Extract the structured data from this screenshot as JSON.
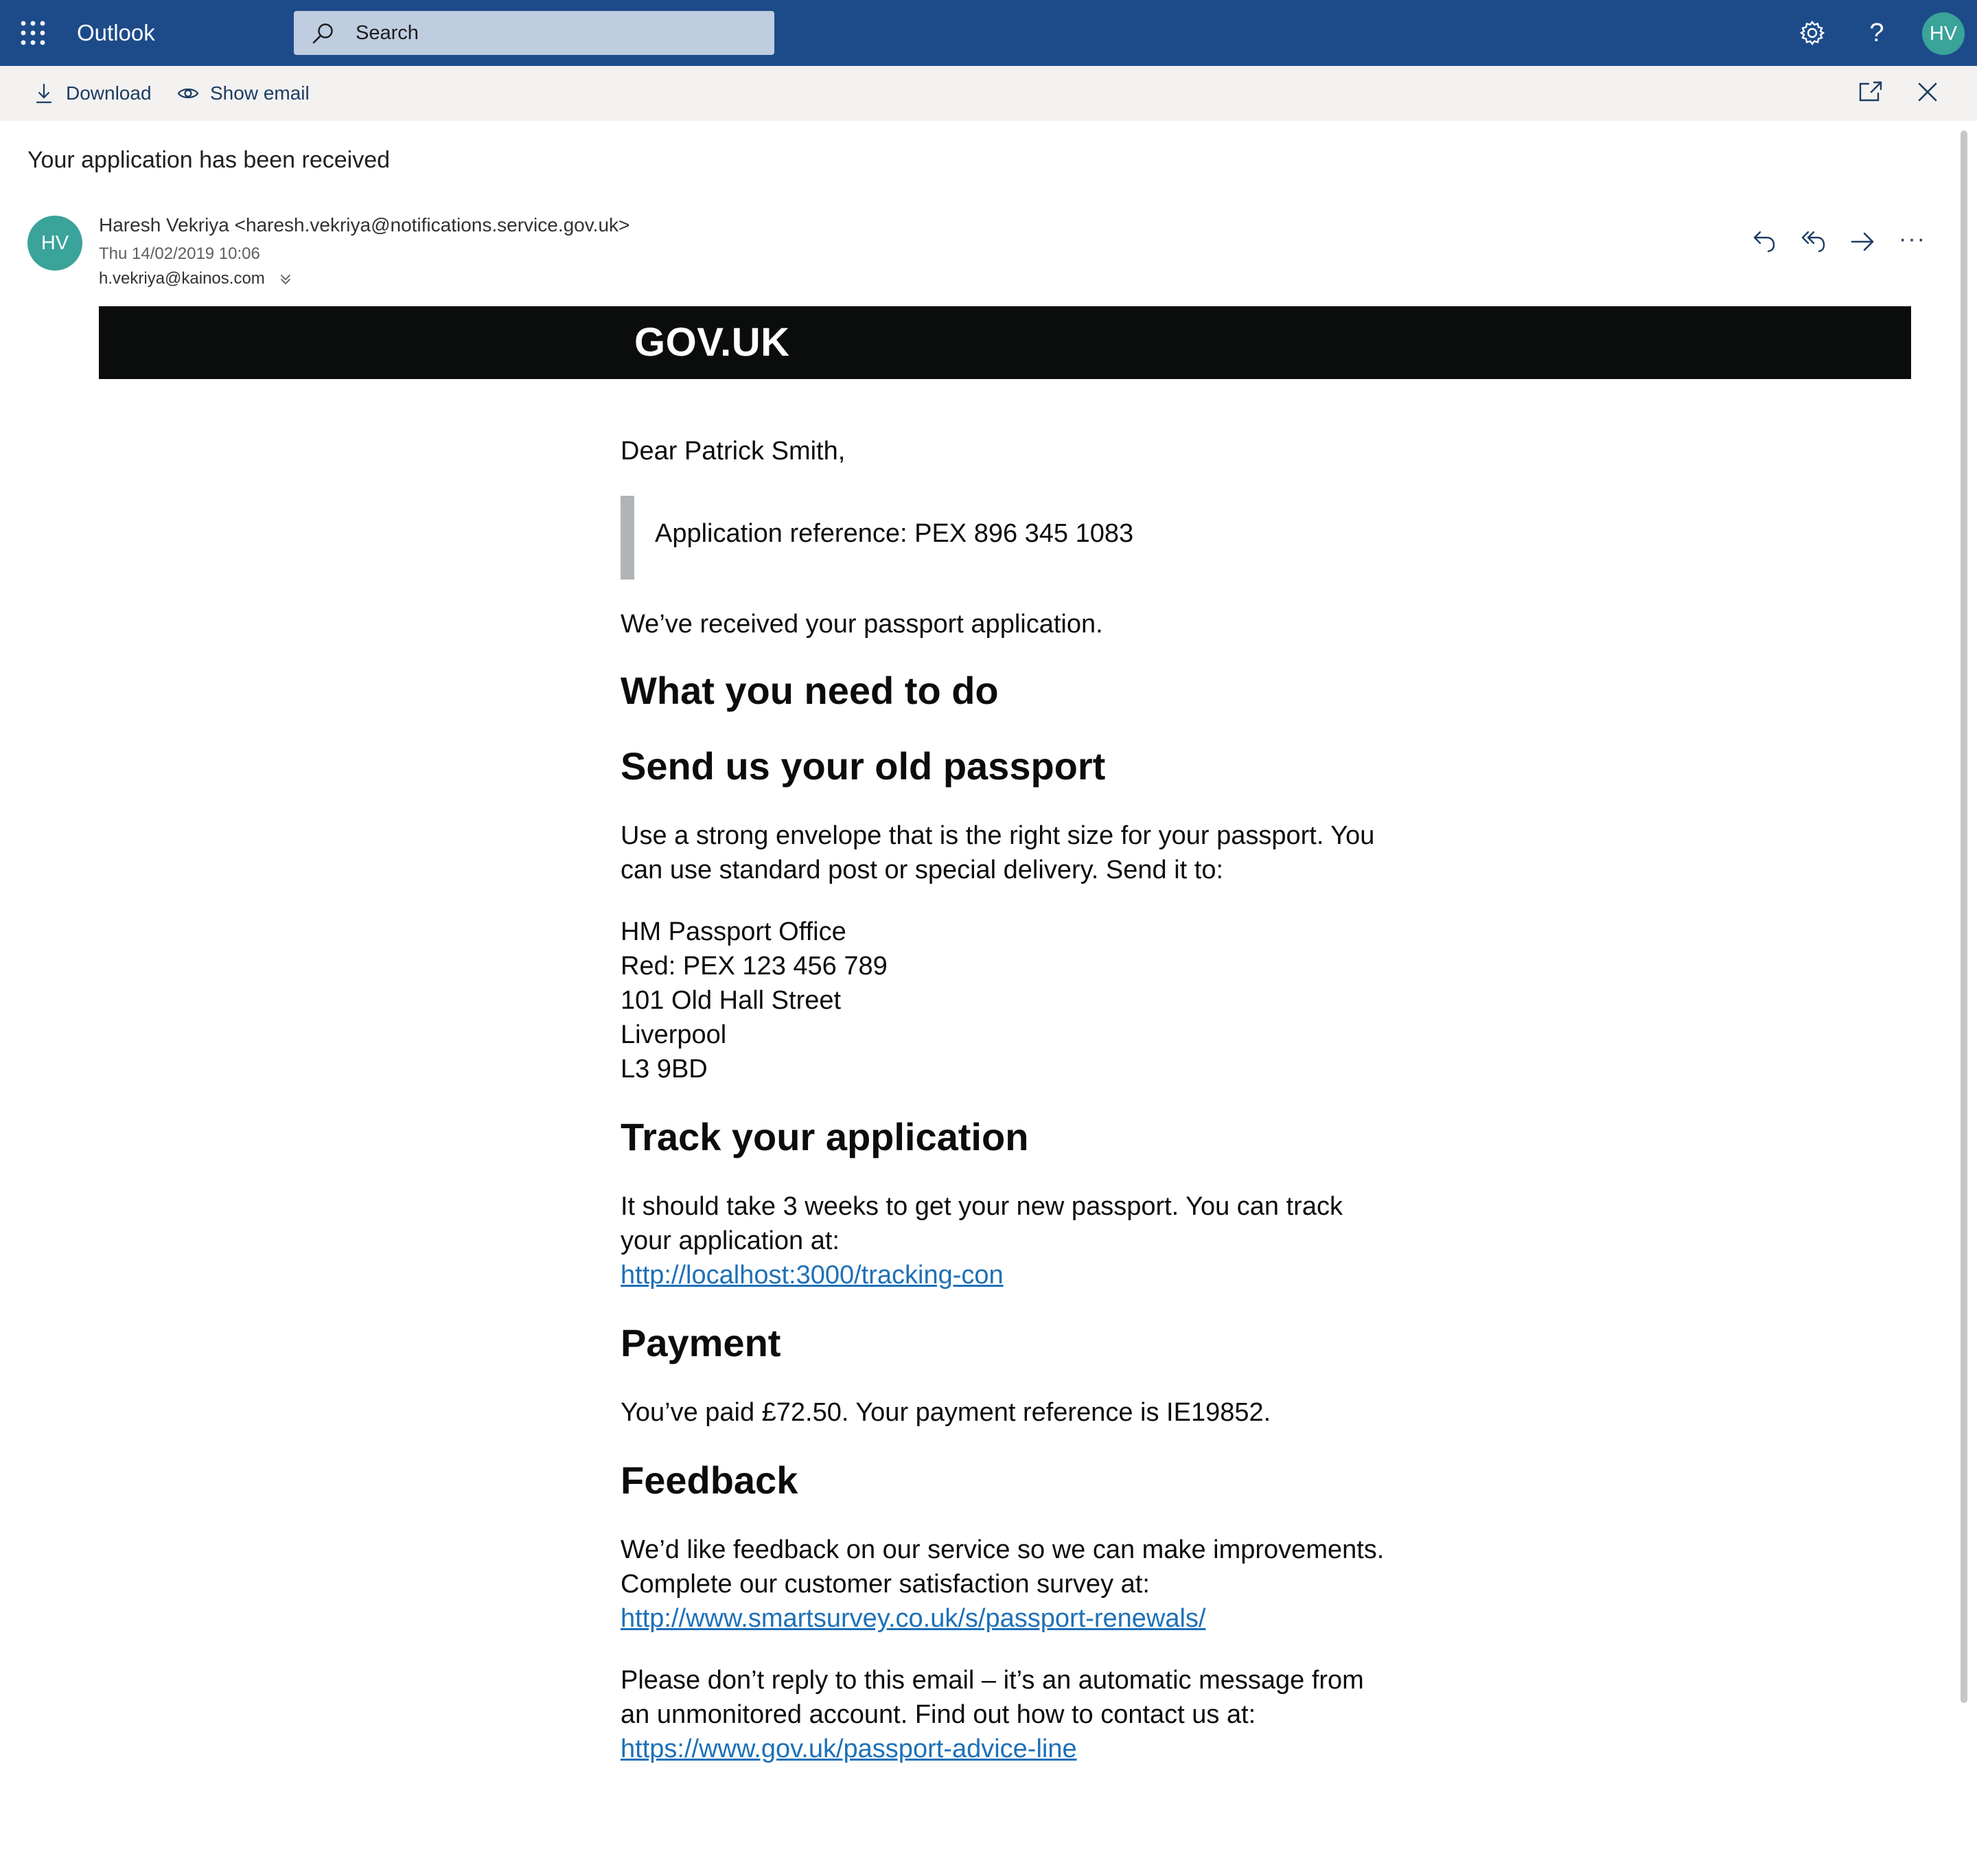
{
  "suite": {
    "app_name": "Outlook",
    "search_placeholder": "Search",
    "help_glyph": "?",
    "user_initials": "HV",
    "bar_color": "#1d4b8a",
    "icons": [
      "app-launcher-icon",
      "search-icon",
      "settings-gear-icon",
      "help-icon"
    ]
  },
  "commands": {
    "download_label": "Download",
    "show_email_label": "Show email",
    "icons": [
      "download-icon",
      "eye-icon",
      "open-in-new-window-icon",
      "close-icon"
    ]
  },
  "message": {
    "subject": "Your application has been received",
    "sender_initials": "HV",
    "sender": "Haresh Vekriya <haresh.vekriya@notifications.service.gov.uk>",
    "date": "Thu 14/02/2019 10:06",
    "to": "h.vekriya@kainos.com",
    "more_glyph": "···",
    "avatar_color": "#3aa39a"
  },
  "email": {
    "banner_logo": "GOV.UK",
    "greeting": "Dear Patrick Smith,",
    "reference": "Application reference: PEX 896 345 1083",
    "received": "We’ve received your passport application.",
    "heading_need": "What you need to do",
    "heading_send": "Send us your old passport",
    "envelope_line1": "Use a strong envelope that is the right size for your passport. You",
    "envelope_line2": "can use standard post or special delivery. Send it to:",
    "address": [
      "HM Passport Office",
      "Red: PEX 123 456 789",
      "101 Old Hall Street",
      "Liverpool",
      "L3 9BD"
    ],
    "heading_track": "Track your application",
    "track_line1": "It should take 3 weeks to get your new passport. You can track",
    "track_line2": "your application at:",
    "track_link": "http://localhost:3000/tracking-con",
    "heading_payment": "Payment",
    "payment_text": "You’ve paid £72.50. Your payment reference is IE19852.",
    "heading_feedback": "Feedback",
    "feedback_line1": "We’d like feedback on our service so we can make improvements.",
    "feedback_line2": "Complete our customer satisfaction survey at:",
    "feedback_link": "http://www.smartsurvey.co.uk/s/passport-renewals/",
    "noreply_line1": "Please don’t reply to this email – it’s an automatic message from",
    "noreply_line2": "an unmonitored account. Find out how to contact us at:",
    "contact_link": "https://www.gov.uk/passport-advice-line",
    "link_color": "#1d70b8",
    "banner_color": "#0b0c0c"
  }
}
